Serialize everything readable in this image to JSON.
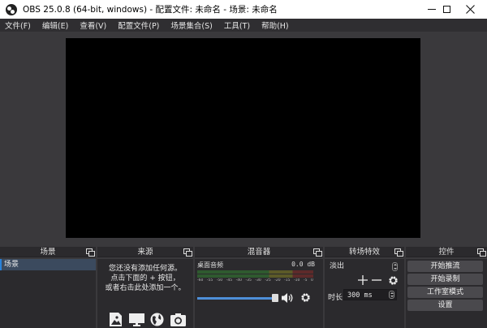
{
  "window": {
    "title": "OBS 25.0.8 (64-bit, windows) - 配置文件: 未命名 - 场景: 未命名"
  },
  "menu": [
    {
      "label": "文件(F)"
    },
    {
      "label": "编辑(E)"
    },
    {
      "label": "查看(V)"
    },
    {
      "label": "配置文件(P)"
    },
    {
      "label": "场景集合(S)"
    },
    {
      "label": "工具(T)"
    },
    {
      "label": "帮助(H)"
    }
  ],
  "docks": {
    "scenes": {
      "title": "场景",
      "items": [
        {
          "label": "场景"
        }
      ]
    },
    "sources": {
      "title": "来源",
      "empty_line1": "您还没有添加任何源。",
      "empty_line2": "点击下面的 + 按钮，",
      "empty_line3": "或者右击此处添加一个。",
      "icons": [
        "image-icon",
        "display-capture-icon",
        "browser-globe-icon",
        "camera-icon"
      ]
    },
    "mixer": {
      "title": "混音器",
      "track_name": "桌面音频",
      "db_value": "0.0 dB",
      "scale": [
        "-60",
        "-55",
        "-50",
        "-45",
        "-40",
        "-35",
        "-30",
        "-25",
        "-20",
        "-15",
        "-10",
        "-5",
        "0"
      ],
      "volume_percent": 100
    },
    "transitions": {
      "title": "转场特效",
      "selected": "淡出",
      "duration_label": "时长",
      "duration_value": "300 ms"
    },
    "controls": {
      "title": "控件",
      "buttons": [
        {
          "label": "开始推流"
        },
        {
          "label": "开始录制"
        },
        {
          "label": "工作室模式"
        },
        {
          "label": "设置"
        }
      ]
    }
  }
}
